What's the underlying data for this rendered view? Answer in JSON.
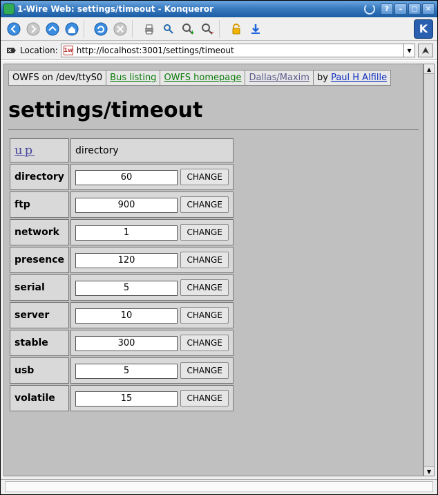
{
  "window": {
    "title": "1-Wire Web: settings/timeout - Konqueror"
  },
  "location": {
    "label": "Location:",
    "url": "http://localhost:3001/settings/timeout"
  },
  "nav": {
    "owfs_on": "OWFS on /dev/ttyS0",
    "bus_listing": "Bus listing",
    "owfs_homepage": "OWFS homepage",
    "dallas_maxim": "Dallas/Maxim",
    "by": "by",
    "author": "Paul H Alfille"
  },
  "page": {
    "heading": "settings/timeout",
    "up_label": "up",
    "dir_label": "directory",
    "change_label": "CHANGE",
    "rows": [
      {
        "name": "directory",
        "value": "60"
      },
      {
        "name": "ftp",
        "value": "900"
      },
      {
        "name": "network",
        "value": "1"
      },
      {
        "name": "presence",
        "value": "120"
      },
      {
        "name": "serial",
        "value": "5"
      },
      {
        "name": "server",
        "value": "10"
      },
      {
        "name": "stable",
        "value": "300"
      },
      {
        "name": "usb",
        "value": "5"
      },
      {
        "name": "volatile",
        "value": "15"
      }
    ]
  }
}
